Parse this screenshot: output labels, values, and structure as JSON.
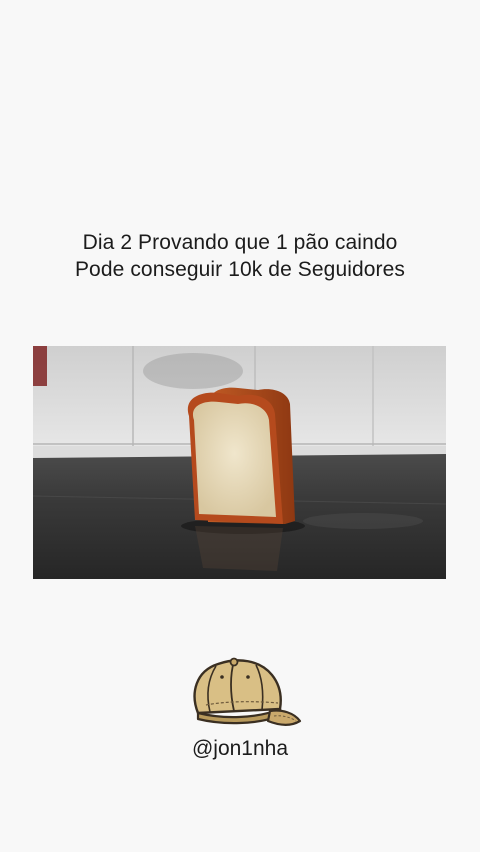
{
  "post": {
    "caption_line1": "Dia 2 Provando que 1 pão caindo",
    "caption_line2": "Pode conseguir 10k de Seguidores"
  },
  "video": {
    "subject": "slice of bread standing on kitchen counter"
  },
  "brand": {
    "logo_icon": "cap-icon",
    "handle": "@jon1nha"
  },
  "colors": {
    "background": "#f8f8f8",
    "text": "#1c1c1c",
    "cap_fill": "#d9bf85",
    "cap_outline": "#3a2f22"
  }
}
